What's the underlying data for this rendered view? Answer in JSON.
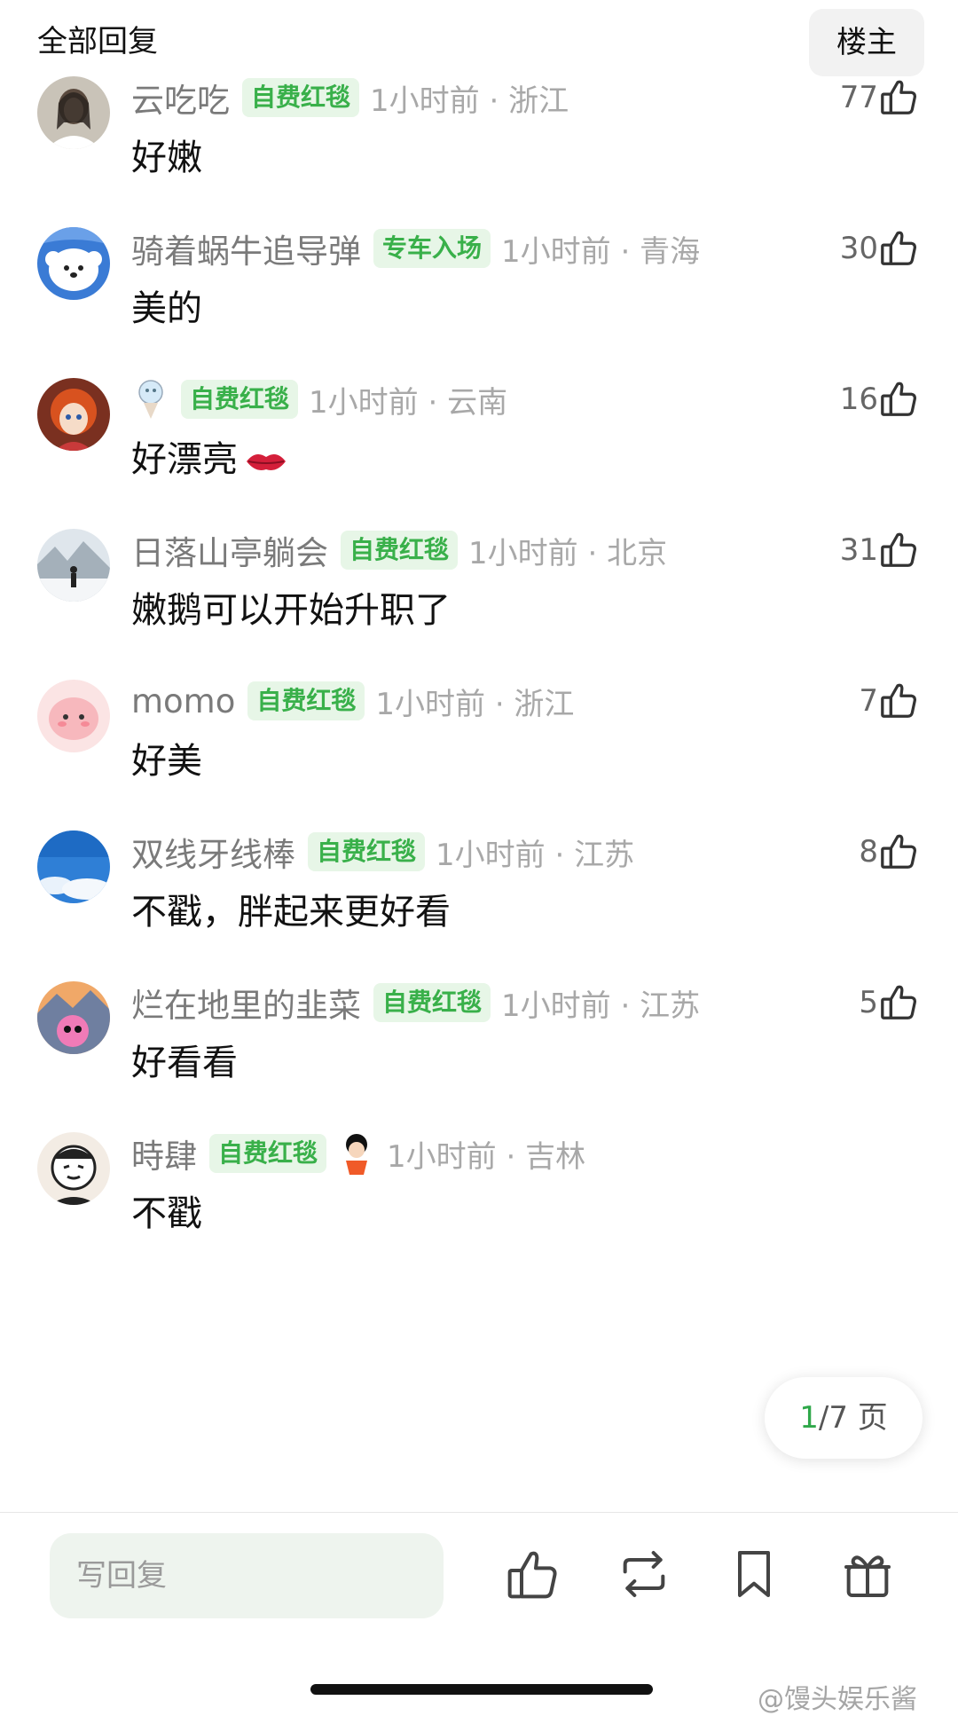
{
  "header": {
    "title": "全部回复",
    "owner_button": "楼主"
  },
  "comments": [
    {
      "username": "云吃吃",
      "badge": "自费红毯",
      "meta": "1小时前 · 浙江",
      "likes": "77",
      "text": "好嫩"
    },
    {
      "username": "骑着蜗牛追导弹",
      "badge": "专车入场",
      "meta": "1小时前 · 青海",
      "likes": "30",
      "text": "美的"
    },
    {
      "username": "",
      "badge": "自费红毯",
      "meta": "1小时前 · 云南",
      "likes": "16",
      "text": "好漂亮"
    },
    {
      "username": "日落山亭躺会",
      "badge": "自费红毯",
      "meta": "1小时前 · 北京",
      "likes": "31",
      "text": "嫩鹅可以开始升职了"
    },
    {
      "username": "momo",
      "badge": "自费红毯",
      "meta": "1小时前 · 浙江",
      "likes": "7",
      "text": "好美"
    },
    {
      "username": "双线牙线棒",
      "badge": "自费红毯",
      "meta": "1小时前 · 江苏",
      "likes": "8",
      "text": "不戳，胖起来更好看"
    },
    {
      "username": "烂在地里的韭菜",
      "badge": "自费红毯",
      "meta": "1小时前 · 江苏",
      "likes": "5",
      "text": "好看看"
    },
    {
      "username": "時肆",
      "badge": "自费红毯",
      "meta": "1小时前 · 吉林",
      "likes": "",
      "text": "不戳"
    }
  ],
  "pagination": {
    "current": "1",
    "total_text": "/7 页"
  },
  "footer": {
    "reply_placeholder": "写回复"
  },
  "watermark": "@馒头娱乐酱",
  "colors": {
    "badge_text": "#39b04a",
    "badge_bg": "#e7f6e7",
    "page_current": "#2fa84a"
  }
}
